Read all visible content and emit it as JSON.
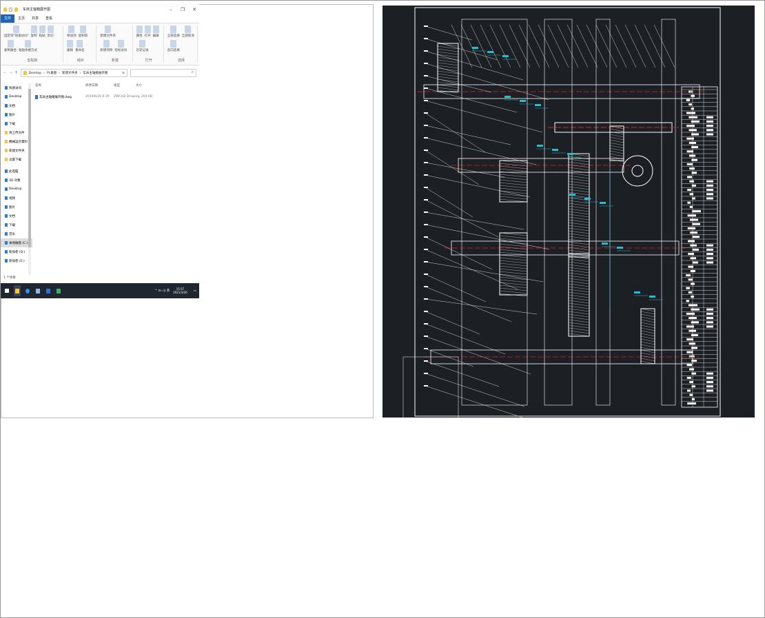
{
  "explorer": {
    "title": "车床主轴箱展开图",
    "window_buttons": [
      "–",
      "❐",
      "✕"
    ],
    "tabs": [
      {
        "label": "文件",
        "active": true
      },
      {
        "label": "主页"
      },
      {
        "label": "共享"
      },
      {
        "label": "查看"
      }
    ],
    "ribbon": [
      {
        "group": "剪贴板",
        "items": [
          "固定到\"快速访问\"",
          "复制",
          "粘贴",
          "剪切",
          "复制路径",
          "粘贴快捷方式"
        ]
      },
      {
        "group": "组织",
        "items": [
          "移动到",
          "复制到",
          "删除",
          "重命名"
        ]
      },
      {
        "group": "新建",
        "items": [
          "新建文件夹",
          "新建项目",
          "轻松访问"
        ]
      },
      {
        "group": "打开",
        "items": [
          "属性",
          "打开",
          "编辑",
          "历史记录"
        ]
      },
      {
        "group": "选择",
        "items": [
          "全部选择",
          "全部取消",
          "反向选择"
        ]
      }
    ],
    "address": {
      "path": [
        "Desktop",
        "PL素图",
        "新建文件夹",
        "车床主轴箱展开图"
      ],
      "search_placeholder": "⌕"
    },
    "sidebar": [
      {
        "label": "快速访问",
        "icon": "star-icon"
      },
      {
        "label": "Desktop",
        "icon": "desktop-icon"
      },
      {
        "label": "文档",
        "icon": "document-icon"
      },
      {
        "label": "图片",
        "icon": "picture-icon"
      },
      {
        "label": "下载",
        "icon": "download-icon"
      },
      {
        "label": "待上传文件",
        "icon": "folder-icon"
      },
      {
        "label": "機械設計資料",
        "icon": "folder-icon"
      },
      {
        "label": "新建文件夹",
        "icon": "folder-icon"
      },
      {
        "label": "迅雷下载",
        "icon": "folder-icon"
      },
      {
        "label": "此电脑",
        "icon": "computer-icon"
      },
      {
        "label": "3D 对象",
        "icon": "cube-icon"
      },
      {
        "label": "Desktop",
        "icon": "desktop-icon"
      },
      {
        "label": "视频",
        "icon": "video-icon"
      },
      {
        "label": "图片",
        "icon": "picture-icon"
      },
      {
        "label": "文档",
        "icon": "document-icon"
      },
      {
        "label": "下载",
        "icon": "download-icon"
      },
      {
        "label": "音乐",
        "icon": "music-icon"
      },
      {
        "label": "本地磁盘 (C:)",
        "icon": "drive-icon",
        "selected": true
      },
      {
        "label": "新加卷 (D:)",
        "icon": "drive-icon"
      },
      {
        "label": "新加卷 (E:)",
        "icon": "drive-icon"
      }
    ],
    "columns": [
      "名称",
      "修改日期",
      "类型",
      "大小"
    ],
    "files": [
      {
        "name": "车床主轴箱展开图.dwg",
        "modified": "2019/6/20 9:39",
        "type": "ZWCAD Drawing",
        "size": "204 KB"
      }
    ],
    "status": "1 个项目",
    "taskbar": {
      "time": "15:57",
      "date": "2021/3/26",
      "tray": "^ ⊡ ◁) 英"
    }
  },
  "cad": {
    "description_colors": {
      "background": "#1c1f24",
      "lines": "#ffffff",
      "center": "#e02020",
      "dims": "#20c0d0"
    }
  }
}
